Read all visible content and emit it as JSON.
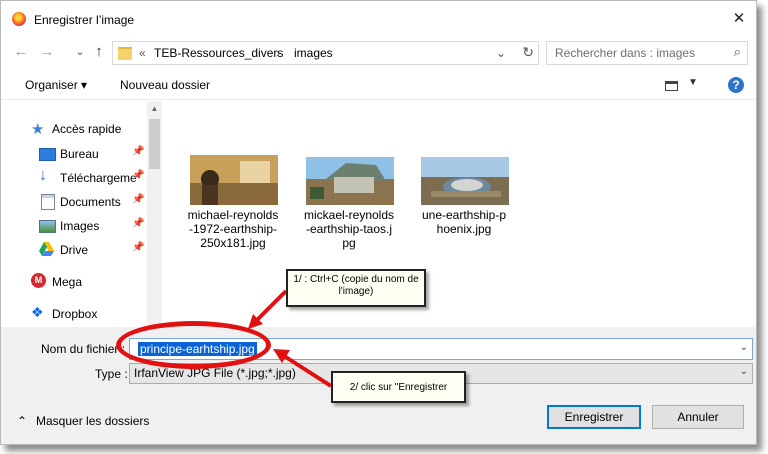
{
  "window": {
    "title": "Enregistrer l’image",
    "close_glyph": "✕"
  },
  "nav": {
    "back": "←",
    "forward": "→",
    "up_caret": "⌄",
    "up": "↑"
  },
  "address": {
    "chevrons": "«",
    "segments": [
      "TEB-Ressources_divers",
      "images"
    ],
    "separator": "›",
    "refresh": "↻"
  },
  "search": {
    "placeholder": "Rechercher dans : images",
    "icon": "⌕"
  },
  "toolbar": {
    "organize_label": "Organiser ▾",
    "new_folder_label": "Nouveau dossier",
    "help": "?"
  },
  "sidebar": {
    "items": [
      {
        "label": "Accès rapide",
        "icon": "star-icon",
        "pinned": false
      },
      {
        "label": "Bureau",
        "icon": "desktop-icon",
        "pinned": true
      },
      {
        "label": "Téléchargeme",
        "icon": "download-icon",
        "pinned": true
      },
      {
        "label": "Documents",
        "icon": "documents-icon",
        "pinned": true
      },
      {
        "label": "Images",
        "icon": "images-icon",
        "pinned": true
      },
      {
        "label": "Drive",
        "icon": "drive-icon",
        "pinned": true
      },
      {
        "label": "Mega",
        "icon": "mega-icon",
        "pinned": false
      },
      {
        "label": "Dropbox",
        "icon": "dropbox-icon",
        "pinned": false
      }
    ],
    "pin_glyph": "📌"
  },
  "files": [
    {
      "lines": [
        "michael-reynolds",
        "-1972-earthship-",
        "250x181.jpg"
      ]
    },
    {
      "lines": [
        "mickael-reynolds",
        "-earthship-taos.j",
        "pg"
      ]
    },
    {
      "lines": [
        "une-earthship-p",
        "hoenix.jpg"
      ]
    }
  ],
  "form": {
    "filename_label": "Nom du fichier :",
    "filename_value": "principe-earhtship.jpg",
    "type_label": "Type :",
    "type_value": "IrfanView JPG File (*.jpg;*.jpg)"
  },
  "footer": {
    "hide_folders": "Masquer les dossiers",
    "hide_caret": "⌃",
    "save_label": "Enregistrer",
    "cancel_label": "Annuler"
  },
  "annotations": {
    "callout1": "1/ : Ctrl+C (copie du nom de l'image)",
    "callout2": "2/ clic sur \"Enregistrer"
  },
  "colors": {
    "accent": "#0078d7",
    "annotation_red": "#e21111",
    "selection": "#0a64d6"
  }
}
